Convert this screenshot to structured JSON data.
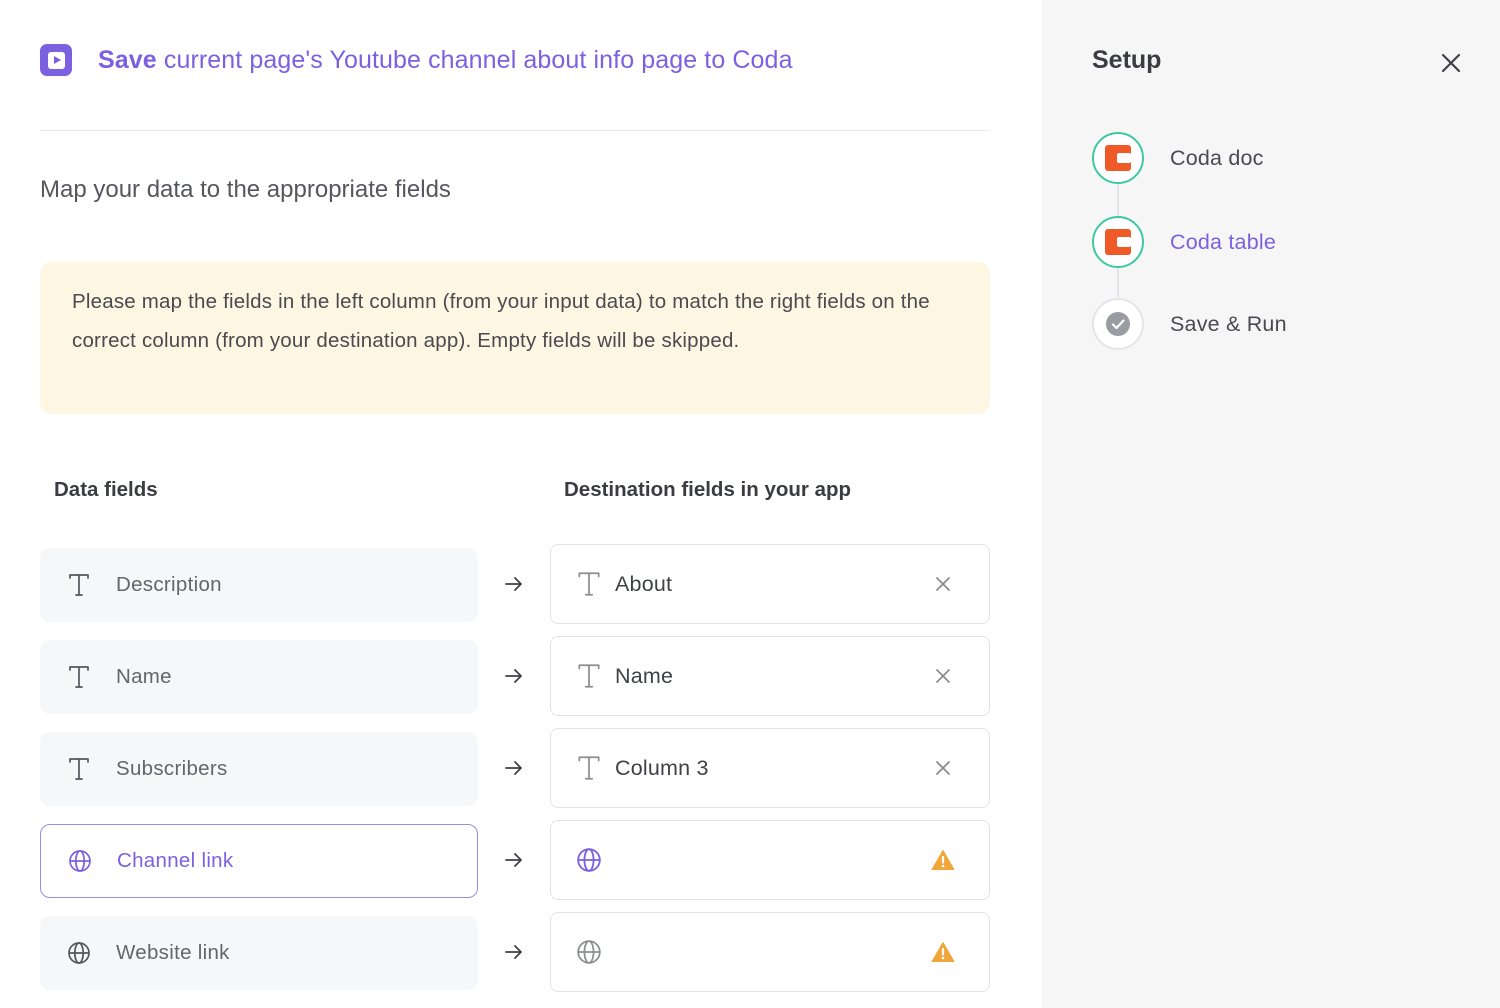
{
  "header": {
    "title_bold": "Save",
    "title_rest": " current page's Youtube channel about info page to Coda",
    "accent_color": "#7b61e0"
  },
  "main": {
    "subheading": "Map your data to the appropriate fields",
    "notice": "Please map the fields in the left column (from your input data) to match the right fields on the correct column (from your destination app). Empty fields will be skipped.",
    "data_fields_header": "Data fields",
    "destination_header": "Destination fields in your app",
    "mappings": [
      {
        "source_icon": "text-type-icon",
        "source": "Description",
        "dest_icon": "text-type-icon",
        "dest": "About",
        "action": "clear-icon"
      },
      {
        "source_icon": "text-type-icon",
        "source": "Name",
        "dest_icon": "text-type-icon",
        "dest": "Name",
        "action": "clear-icon"
      },
      {
        "source_icon": "text-type-icon",
        "source": "Subscribers",
        "dest_icon": "text-type-icon",
        "dest": "Column 3",
        "action": "clear-icon"
      },
      {
        "source_icon": "globe-icon",
        "source": "Channel link",
        "selected": true,
        "dest_icon": "globe-icon",
        "dest": "",
        "action": "warning-icon"
      },
      {
        "source_icon": "globe-icon",
        "source": "Website link",
        "dest_icon": "globe-icon",
        "dest": "",
        "action": "warning-icon"
      }
    ]
  },
  "sidebar": {
    "title": "Setup",
    "steps": [
      {
        "label": "Coda doc",
        "icon": "coda-logo-icon",
        "status": "complete"
      },
      {
        "label": "Coda table",
        "icon": "coda-logo-icon",
        "status": "active"
      },
      {
        "label": "Save & Run",
        "icon": "check-circle-icon",
        "status": "pending"
      }
    ]
  },
  "colors": {
    "accent": "#7b61e0",
    "notice_bg": "#fdf6e3",
    "step_complete": "#3cc9a1",
    "coda_orange": "#f05a28",
    "warning": "#f0a63a"
  }
}
